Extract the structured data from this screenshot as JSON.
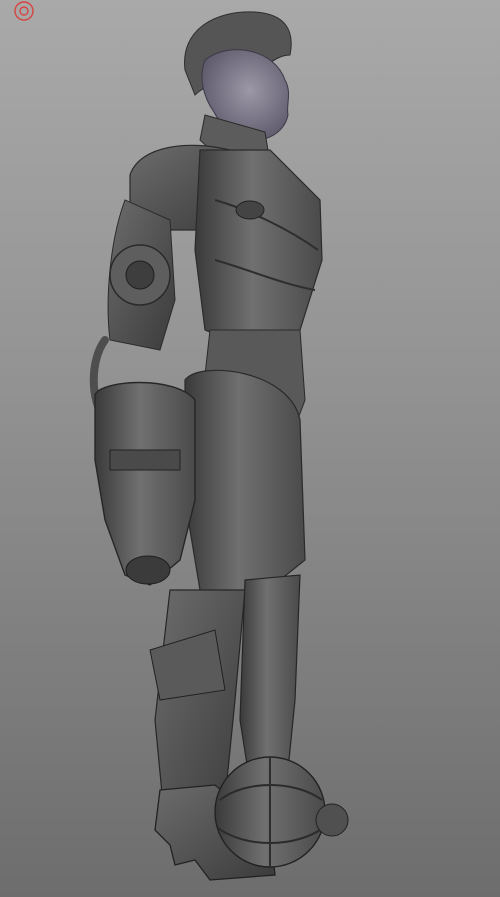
{
  "scene": {
    "subject_icon": "sculpt-figure-icon",
    "corner_icon": "target-circle-icon",
    "colors": {
      "background_top": "#a9a9a9",
      "background_bottom": "#6d6d6d",
      "clay_dark": "#2f2f2f",
      "clay_mid": "#5a5a5a",
      "clay_light": "#8a8a8a",
      "skin_tint": "#8e8aa0",
      "corner_icon": "#d7443f"
    }
  }
}
